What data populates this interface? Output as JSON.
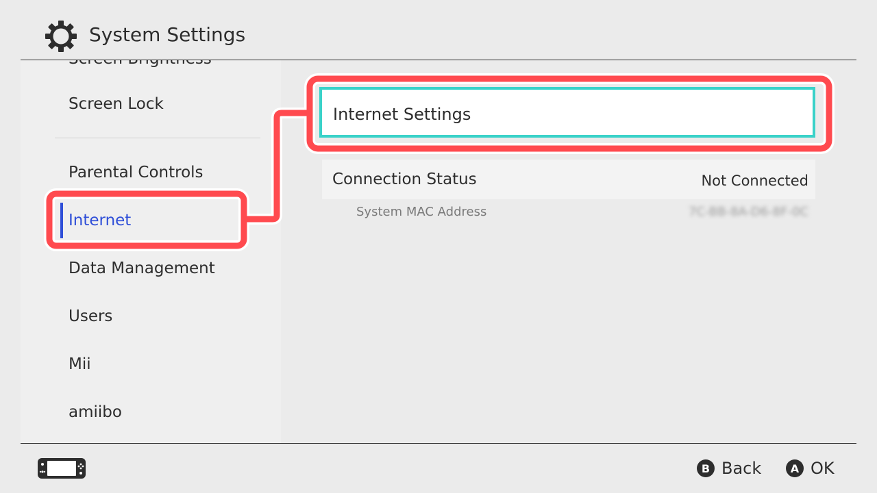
{
  "header": {
    "title": "System Settings",
    "icon": "gear-icon"
  },
  "sidebar": {
    "items": [
      {
        "label": "Screen Brightness"
      },
      {
        "label": "Screen Lock"
      },
      {
        "label": "Parental Controls"
      },
      {
        "label": "Internet"
      },
      {
        "label": "Data Management"
      },
      {
        "label": "Users"
      },
      {
        "label": "Mii"
      },
      {
        "label": "amiibo"
      }
    ],
    "selected": "Internet"
  },
  "main": {
    "internet_settings_label": "Internet Settings",
    "connection_status_label": "Connection Status",
    "connection_status_value": "Not Connected",
    "mac_label": "System MAC Address",
    "mac_value": "7C-BB-8A-D6-8F-0C"
  },
  "footer": {
    "back_key": "B",
    "back_label": "Back",
    "ok_key": "A",
    "ok_label": "OK"
  },
  "colors": {
    "accent_selected": "#2f4fd8",
    "focus_border": "#3ad2c9",
    "annotation": "#ff4a4f"
  }
}
